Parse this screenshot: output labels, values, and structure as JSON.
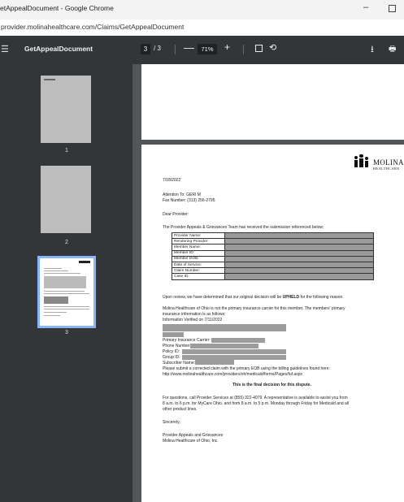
{
  "window": {
    "title": "etAppealDocument - Google Chrome",
    "minimize": "–"
  },
  "address_bar": {
    "url": "provider.molinahealthcare.com/Claims/GetAppealDocument"
  },
  "toolbar": {
    "menu_icon": "☰",
    "document_title": "GetAppealDocument",
    "current_page": "3",
    "page_total": "/ 3",
    "zoom_out": "—",
    "zoom_level": "71%",
    "zoom_in": "+",
    "rotate_icon": "⟲",
    "download_icon": "⭳",
    "print_icon": "🖶"
  },
  "thumbnails": [
    {
      "label": "1"
    },
    {
      "label": "2"
    },
    {
      "label": "3",
      "selected": true
    }
  ],
  "letter": {
    "logo": {
      "name": "MOLINA",
      "sub": "HEALTHCARE"
    },
    "date": "7/18/2022",
    "attention": "Attention To: GERI M",
    "fax": "Fax Number: (313) 256-2795",
    "greeting": "Dear Provider:",
    "intro": "The Provider Appeals & Grievances Team has received the submission referenced below:",
    "table_rows": [
      "Provider Name:",
      "Rendering Provider:",
      "Member Name:",
      "Member ID:",
      "Member DOB:",
      "Date of Service:",
      "Claim Number:",
      "Case ID:"
    ],
    "decision_pre": "Upon review, we have determined that our original decision will be ",
    "decision_bold": "UPHELD",
    "decision_post": " for the following reason.",
    "para1_line1": "Molina Healthcare of Ohio is not the primary insurance carrier for this member. The members' primary",
    "para1_line2": "insurance information is as follows:",
    "info_verified": "Information Verified on 7/11/2022",
    "primary_carrier": "Primary Insurance Carrier:",
    "phone_number": "Phone Number:",
    "policy_id": "Policy ID:",
    "group_id": "Group ID:",
    "subscriber_name": "Subscriber Name:",
    "submit_line": "Please submit a corrected claim with the primary EOB using the billing guidelines found here:",
    "url_line": "http://www.molinahealthcare.com/providers/oh/medicaid/forms/Pages/fuf.aspx",
    "final_decision": "This is the final decision for this dispute.",
    "questions_line1": "For questions, call Provider Services at (855) 322-4079. A representative is available to assist you from",
    "questions_line2": "8 a.m. to 6 p.m. for MyCare Ohio, and from 8 a.m. to 5 p.m. Monday through Friday for Medicaid and all",
    "questions_line3": "other product lines.",
    "closing": "Sincerely,",
    "sig1": "Provider Appeals and Grievances",
    "sig2": "Molina Healthcare of Ohio, Inc."
  }
}
